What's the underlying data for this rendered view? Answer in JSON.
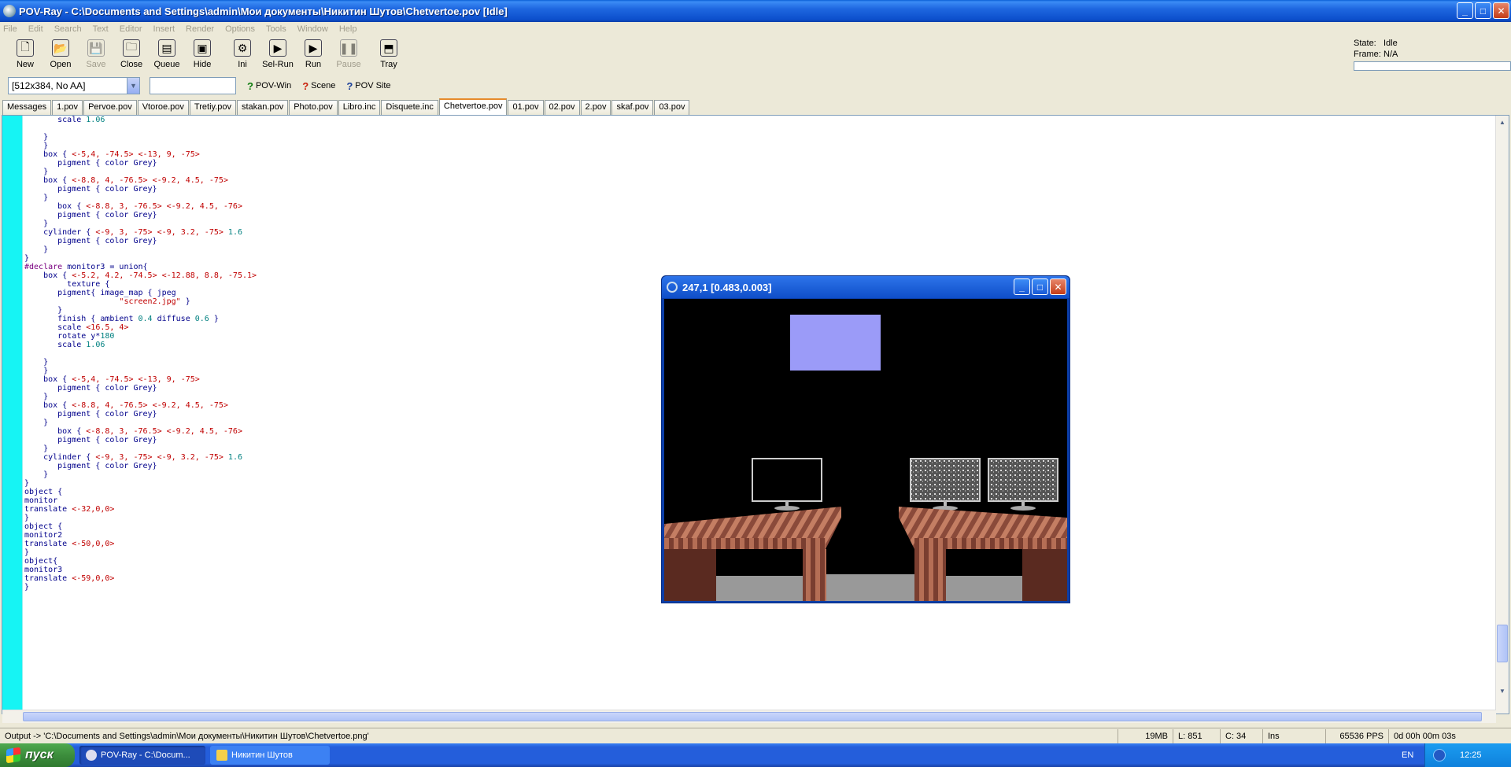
{
  "window": {
    "title": "POV-Ray - C:\\Documents and Settings\\admin\\Мои документы\\Никитин Шутов\\Chetvertoe.pov [Idle]",
    "minimize": "_",
    "maximize": "□",
    "close": "✕"
  },
  "menu": [
    "File",
    "Edit",
    "Search",
    "Text",
    "Editor",
    "Insert",
    "Render",
    "Options",
    "Tools",
    "Window",
    "Help"
  ],
  "toolbar": [
    {
      "label": "New",
      "icon": "new-file-icon",
      "glyph": "🗋",
      "enabled": true
    },
    {
      "label": "Open",
      "icon": "open-folder-icon",
      "glyph": "📂",
      "enabled": true
    },
    {
      "label": "Save",
      "icon": "save-disk-icon",
      "glyph": "💾",
      "enabled": false
    },
    {
      "label": "Close",
      "icon": "close-folder-icon",
      "glyph": "🗀",
      "enabled": true
    },
    {
      "label": "Queue",
      "icon": "queue-icon",
      "glyph": "▤",
      "enabled": true
    },
    {
      "label": "Hide",
      "icon": "hide-icon",
      "glyph": "▣",
      "enabled": true
    },
    {
      "label": "Ini",
      "icon": "ini-icon",
      "glyph": "⚙",
      "enabled": true
    },
    {
      "label": "Sel-Run",
      "icon": "sel-run-icon",
      "glyph": "▶",
      "enabled": true
    },
    {
      "label": "Run",
      "icon": "run-icon",
      "glyph": "▶",
      "enabled": true
    },
    {
      "label": "Pause",
      "icon": "pause-icon",
      "glyph": "❚❚",
      "enabled": false
    },
    {
      "label": "Tray",
      "icon": "tray-icon",
      "glyph": "⬒",
      "enabled": true
    }
  ],
  "state": {
    "state_label": "State:",
    "state_value": "Idle",
    "frame_label": "Frame:",
    "frame_value": "N/A"
  },
  "toolbar2": {
    "resolution": "[512x384, No AA]",
    "povwin": "POV-Win",
    "scene": "Scene",
    "povsite": "POV Site"
  },
  "tabs": [
    {
      "label": "Messages",
      "active": false
    },
    {
      "label": "1.pov",
      "active": false
    },
    {
      "label": "Pervoe.pov",
      "active": false
    },
    {
      "label": "Vtoroe.pov",
      "active": false
    },
    {
      "label": "Tretiy.pov",
      "active": false
    },
    {
      "label": "stakan.pov",
      "active": false
    },
    {
      "label": "Photo.pov",
      "active": false
    },
    {
      "label": "Libro.inc",
      "active": false
    },
    {
      "label": "Disquete.inc",
      "active": false
    },
    {
      "label": "Chetvertoe.pov",
      "active": true
    },
    {
      "label": "01.pov",
      "active": false
    },
    {
      "label": "02.pov",
      "active": false
    },
    {
      "label": "2.pov",
      "active": false
    },
    {
      "label": "skaf.pov",
      "active": false
    },
    {
      "label": "03.pov",
      "active": false
    }
  ],
  "code_lines": [
    "       scale 1.06",
    "",
    "    }",
    "    }",
    "    box { <-5,4, -74.5> <-13, 9, -75>",
    "       pigment { color Grey}",
    "    }",
    "    box { <-8.8, 4, -76.5> <-9.2, 4.5, -75>",
    "       pigment { color Grey}",
    "    }",
    "       box { <-8.8, 3, -76.5> <-9.2, 4.5, -76>",
    "       pigment { color Grey}",
    "    }",
    "    cylinder { <-9, 3, -75> <-9, 3.2, -75> 1.6",
    "       pigment { color Grey}",
    "    }",
    "}",
    "#declare monitor3 = union{",
    "    box { <-5.2, 4.2, -74.5> <-12.88, 8.8, -75.1>",
    "         texture {",
    "       pigment{ image_map { jpeg",
    "                    \"screen2.jpg\" }",
    "       }",
    "       finish { ambient 0.4 diffuse 0.6 }",
    "       scale <16.5, 4>",
    "       rotate y*180",
    "       scale 1.06",
    "",
    "    }",
    "    }",
    "    box { <-5,4, -74.5> <-13, 9, -75>",
    "       pigment { color Grey}",
    "    }",
    "    box { <-8.8, 4, -76.5> <-9.2, 4.5, -75>",
    "       pigment { color Grey}",
    "    }",
    "       box { <-8.8, 3, -76.5> <-9.2, 4.5, -76>",
    "       pigment { color Grey}",
    "    }",
    "    cylinder { <-9, 3, -75> <-9, 3.2, -75> 1.6",
    "       pigment { color Grey}",
    "    }",
    "}",
    "object {",
    "monitor",
    "translate <-32,0,0>",
    "}",
    "object {",
    "monitor2",
    "translate <-50,0,0>",
    "}",
    "object{",
    "monitor3",
    "translate <-59,0,0>",
    "}"
  ],
  "render_window": {
    "title": "247,1 [0.483,0.003]"
  },
  "statusbar": {
    "output": "Output -> 'C:\\Documents and Settings\\admin\\Мои документы\\Никитин Шутов\\Chetvertoe.png'",
    "memory": "19MB",
    "line": "L: 851",
    "col": "C: 34",
    "mode": "Ins",
    "pps": "65536 PPS",
    "elapsed": "0d 00h 00m 03s"
  },
  "taskbar": {
    "start": "пуск",
    "tasks": [
      {
        "label": "POV-Ray - C:\\Docum...",
        "active": true
      },
      {
        "label": "Никитин Шутов",
        "active": false
      }
    ],
    "lang": "EN",
    "clock": "12:25"
  },
  "colors": {
    "gutter": "#16f4f4",
    "code_text": "#00008b",
    "code_number": "#008080",
    "code_string": "#c00000",
    "code_keyword": "#7a0080",
    "tab_accent": "#e68b2c"
  }
}
